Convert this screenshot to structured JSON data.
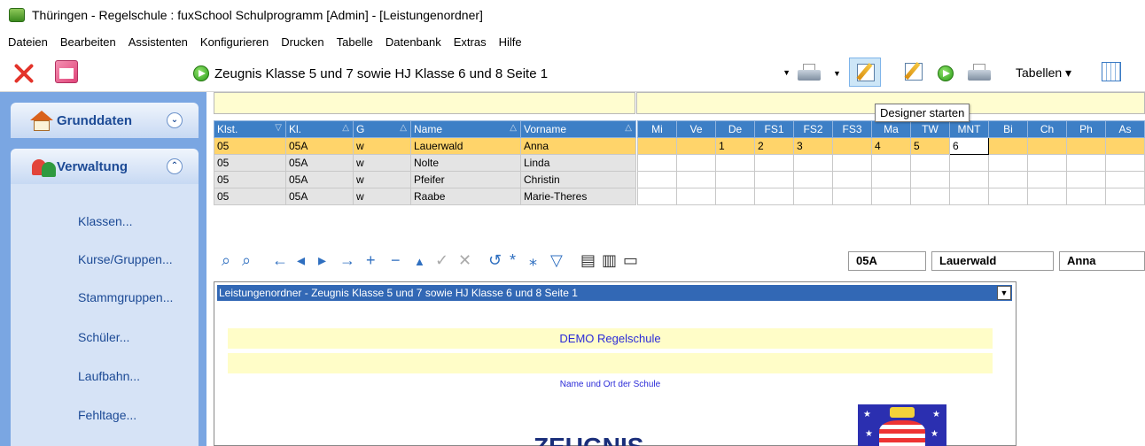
{
  "window": {
    "title": "Thüringen - Regelschule : fuxSchool Schulprogramm [Admin] - [Leistungenordner]"
  },
  "menu": [
    {
      "label": "Dateien"
    },
    {
      "label": "Bearbeiten"
    },
    {
      "label": "Assistenten"
    },
    {
      "label": "Konfigurieren"
    },
    {
      "label": "Drucken"
    },
    {
      "label": "Tabelle"
    },
    {
      "label": "Datenbank"
    },
    {
      "label": "Extras"
    },
    {
      "label": "Hilfe"
    }
  ],
  "toolbar": {
    "report_selected": "Zeugnis Klasse 5 und 7 sowie HJ Klasse 6 und 8 Seite 1",
    "tabellen_label": "Tabellen ▾",
    "tooltip": "Designer starten"
  },
  "sidebar": {
    "grunddaten": "Grunddaten",
    "verwaltung": "Verwaltung",
    "links": [
      "Klassen...",
      "Kurse/Gruppen...",
      "Stammgruppen...",
      "Schüler...",
      "Laufbahn...",
      "Fehltage..."
    ]
  },
  "grid": {
    "left_headers": [
      "Klst.",
      "Kl.",
      "G",
      "Name",
      "Vorname"
    ],
    "right_headers": [
      "Mi",
      "Ve",
      "De",
      "FS1",
      "FS2",
      "FS3",
      "Ma",
      "TW",
      "MNT",
      "Bi",
      "Ch",
      "Ph",
      "As"
    ],
    "rows": [
      {
        "klst": "05",
        "kl": "05A",
        "g": "w",
        "name": "Lauerwald",
        "vorname": "Anna",
        "grades": [
          "",
          "",
          "1",
          "2",
          "3",
          "",
          "4",
          "5",
          "6",
          "",
          "",
          "",
          ""
        ]
      },
      {
        "klst": "05",
        "kl": "05A",
        "g": "w",
        "name": "Nolte",
        "vorname": "Linda",
        "grades": [
          "",
          "",
          "",
          "",
          "",
          "",
          "",
          "",
          "",
          "",
          "",
          "",
          ""
        ]
      },
      {
        "klst": "05",
        "kl": "05A",
        "g": "w",
        "name": "Pfeifer",
        "vorname": "Christin",
        "grades": [
          "",
          "",
          "",
          "",
          "",
          "",
          "",
          "",
          "",
          "",
          "",
          "",
          ""
        ]
      },
      {
        "klst": "05",
        "kl": "05A",
        "g": "w",
        "name": "Raabe",
        "vorname": "Marie-Theres",
        "grades": [
          "",
          "",
          "",
          "",
          "",
          "",
          "",
          "",
          "",
          "",
          "",
          "",
          ""
        ]
      }
    ]
  },
  "navigator": {
    "klasse": "05A",
    "name": "Lauerwald",
    "vorname": "Anna"
  },
  "report": {
    "header": "Leistungenordner - Zeugnis Klasse 5 und 7 sowie HJ Klasse 6 und 8 Seite 1",
    "school": "DEMO Regelschule",
    "caption": "Name und Ort der Schule",
    "heading": "ZEUGNIS"
  },
  "colors": {
    "sidebar": "#7aa6e2",
    "header": "#3d7fc6",
    "selected_row": "#ffd46a",
    "accent": "#1c4a95"
  }
}
